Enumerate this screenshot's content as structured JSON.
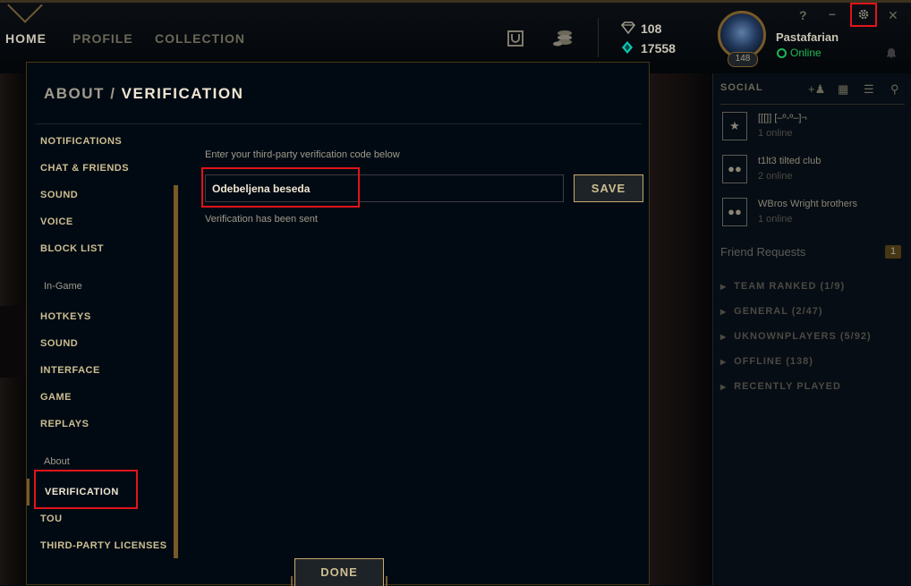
{
  "topbar": {
    "tabs": [
      {
        "label": "HOME",
        "active": true
      },
      {
        "label": "PROFILE",
        "active": false
      },
      {
        "label": "COLLECTION",
        "active": false
      }
    ],
    "currency": {
      "blue_essence": "108",
      "riot_points": "17558"
    },
    "summoner": {
      "name": "Pastafarian",
      "status": "Online",
      "level": "148"
    },
    "window_buttons": {
      "help": "?",
      "minimize": "–",
      "settings": "settings-gear-icon",
      "close": "✕"
    }
  },
  "modal": {
    "breadcrumb": {
      "parent": "ABOUT",
      "separator": "/",
      "current": "VERIFICATION"
    },
    "menu_top": [
      "NOTIFICATIONS",
      "CHAT & FRIENDS",
      "SOUND",
      "VOICE",
      "BLOCK LIST"
    ],
    "section_ingame": "In-Game",
    "menu_ingame": [
      "HOTKEYS",
      "SOUND",
      "INTERFACE",
      "GAME",
      "REPLAYS"
    ],
    "section_about": "About",
    "menu_about": [
      "VERIFICATION",
      "TOU",
      "THIRD-PARTY LICENSES"
    ],
    "content": {
      "label": "Enter your third-party verification code below",
      "code_value": "Odebeljena beseda",
      "save_label": "SAVE",
      "status": "Verification has been sent"
    },
    "done_label": "DONE"
  },
  "social": {
    "title": "SOCIAL",
    "groups": [
      {
        "name": "[[[]] [‒º-º‒]¬",
        "count": "1 online",
        "icon": "star-icon"
      },
      {
        "name": "t1lt3 tilted club",
        "count": "2 online",
        "icon": "group-icon"
      },
      {
        "name": "WBros Wright brothers",
        "count": "1 online",
        "icon": "group-icon"
      }
    ],
    "friend_requests": {
      "label": "Friend Requests",
      "count": "1"
    },
    "folders": [
      "TEAM RANKED (1/9)",
      "GENERAL (2/47)",
      "UKNOWNPLAYERS (5/92)",
      "OFFLINE (138)",
      "RECENTLY PLAYED"
    ]
  },
  "colors": {
    "gold": "#c8aa6e",
    "highlight": "#e0141a",
    "online": "#1db954",
    "background": "#010a13"
  }
}
